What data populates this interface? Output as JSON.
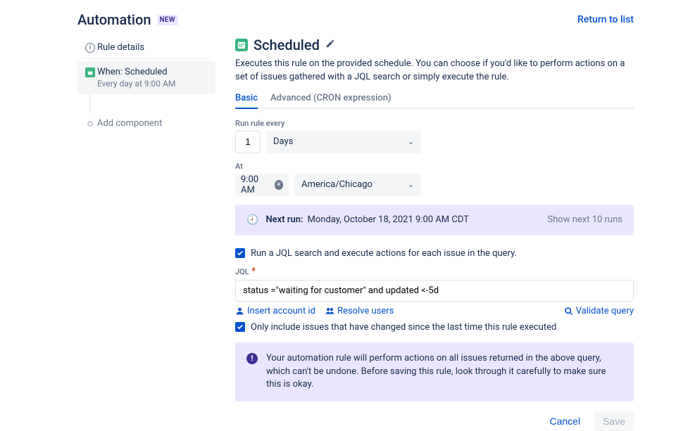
{
  "header": {
    "title": "Automation",
    "badge": "NEW",
    "return": "Return to list"
  },
  "sidebar": {
    "rule_details": "Rule details",
    "when_title": "When: Scheduled",
    "when_sub": "Every day at 9:00 AM",
    "add": "Add component"
  },
  "main": {
    "title": "Scheduled",
    "desc": "Executes this rule on the provided schedule. You can choose if you'd like to perform actions on a set of issues gathered with a JQL search or simply execute the rule.",
    "tabs": {
      "basic": "Basic",
      "advanced": "Advanced (CRON expression)"
    },
    "run_every_label": "Run rule every",
    "run_every_value": "1",
    "run_every_unit": "Days",
    "at_label": "At",
    "at_time": "9:00 AM",
    "timezone": "America/Chicago",
    "next_run_label": "Next run:",
    "next_run_value": "Monday, October 18, 2021 9:00 AM CDT",
    "show_next": "Show next 10 runs",
    "jql_check": "Run a JQL search and execute actions for each issue in the query.",
    "jql_label": "JQL",
    "jql_value": "status =\"waiting for customer\" and updated <-5d",
    "insert_account": "Insert account id",
    "resolve_users": "Resolve users",
    "validate": "Validate query",
    "only_changed": "Only include issues that have changed since the last time this rule executed",
    "warning": "Your automation rule will perform actions on all issues returned in the above query, which can't be undone. Before saving this rule, look through it carefully to make sure this is okay.",
    "cancel": "Cancel",
    "save": "Save"
  }
}
